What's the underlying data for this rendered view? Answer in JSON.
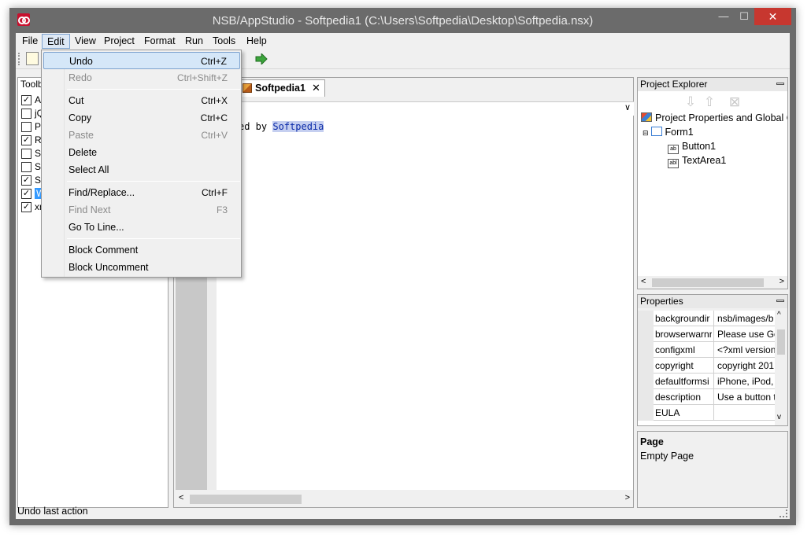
{
  "window": {
    "title": "NSB/AppStudio - Softpedia1 (C:\\Users\\Softpedia\\Desktop\\Softpedia.nsx)",
    "minimize_glyph": "—",
    "maximize_glyph": "☐",
    "close_glyph": "✕"
  },
  "menubar": {
    "items": [
      {
        "label": "File"
      },
      {
        "label": "Edit"
      },
      {
        "label": "View"
      },
      {
        "label": "Project"
      },
      {
        "label": "Format"
      },
      {
        "label": "Run"
      },
      {
        "label": "Tools"
      },
      {
        "label": "Help"
      }
    ]
  },
  "edit_menu": {
    "items": [
      {
        "label": "Undo",
        "shortcut": "Ctrl+Z",
        "state": "highlighted"
      },
      {
        "label": "Redo",
        "shortcut": "Ctrl+Shift+Z",
        "state": "disabled"
      },
      {
        "label": "Cut",
        "shortcut": "Ctrl+X",
        "state": "enabled"
      },
      {
        "label": "Copy",
        "shortcut": "Ctrl+C",
        "state": "enabled"
      },
      {
        "label": "Paste",
        "shortcut": "Ctrl+V",
        "state": "disabled"
      },
      {
        "label": "Delete",
        "shortcut": "",
        "state": "enabled"
      },
      {
        "label": "Select All",
        "shortcut": "",
        "state": "enabled"
      },
      {
        "label": "Find/Replace...",
        "shortcut": "Ctrl+F",
        "state": "enabled"
      },
      {
        "label": "Find Next",
        "shortcut": "F3",
        "state": "disabled"
      },
      {
        "label": "Go To Line...",
        "shortcut": "",
        "state": "enabled"
      },
      {
        "label": "Block Comment",
        "shortcut": "",
        "state": "enabled"
      },
      {
        "label": "Block Uncomment",
        "shortcut": "",
        "state": "enabled"
      }
    ]
  },
  "toolbox": {
    "title": "Toolbo",
    "items": [
      {
        "label": "Ac",
        "checked": true,
        "selected": false
      },
      {
        "label": "jQ",
        "checked": false,
        "selected": false
      },
      {
        "label": "Pl",
        "checked": false,
        "selected": false
      },
      {
        "label": "Re",
        "checked": true,
        "selected": false
      },
      {
        "label": "Se",
        "checked": false,
        "selected": false
      },
      {
        "label": "Sp",
        "checked": false,
        "selected": false
      },
      {
        "label": "St",
        "checked": true,
        "selected": false
      },
      {
        "label": "W",
        "checked": true,
        "selected": true
      },
      {
        "label": "xn",
        "checked": true,
        "selected": false
      }
    ]
  },
  "editor": {
    "tab_label": "Softpedia1",
    "tab_close": "✕",
    "combo_arrow": "∨",
    "code_prefix": "ed by ",
    "code_selected": "Softpedia"
  },
  "project_explorer": {
    "title": "Project Explorer",
    "tree": [
      {
        "label": "Project Properties and Global Co",
        "icon": "cube-icon"
      },
      {
        "label": "Form1",
        "icon": "form-icon"
      },
      {
        "label": "Button1",
        "icon": "button-icon",
        "icon_text": "ab"
      },
      {
        "label": "TextArea1",
        "icon": "textarea-icon",
        "icon_text": "abl"
      }
    ]
  },
  "properties": {
    "title": "Properties",
    "rows": [
      {
        "name": "backgroundir",
        "value": "nsb/images/b"
      },
      {
        "name": "browserwarnr",
        "value": "Please use Go"
      },
      {
        "name": "configxml",
        "value": "<?xml version"
      },
      {
        "name": "copyright",
        "value": "copyright 201"
      },
      {
        "name": "defaultformsi",
        "value": "iPhone, iPod,"
      },
      {
        "name": "description",
        "value": "Use a button t"
      },
      {
        "name": "EULA",
        "value": ""
      }
    ]
  },
  "description_panel": {
    "title": "Page",
    "text": "Empty Page"
  },
  "statusbar": {
    "text": "Undo last action"
  },
  "colors": {
    "titlebar": "#6b6b6b",
    "close_button": "#c7372f",
    "selection": "#3399ff",
    "menu_highlight": "#d5e7f8"
  }
}
